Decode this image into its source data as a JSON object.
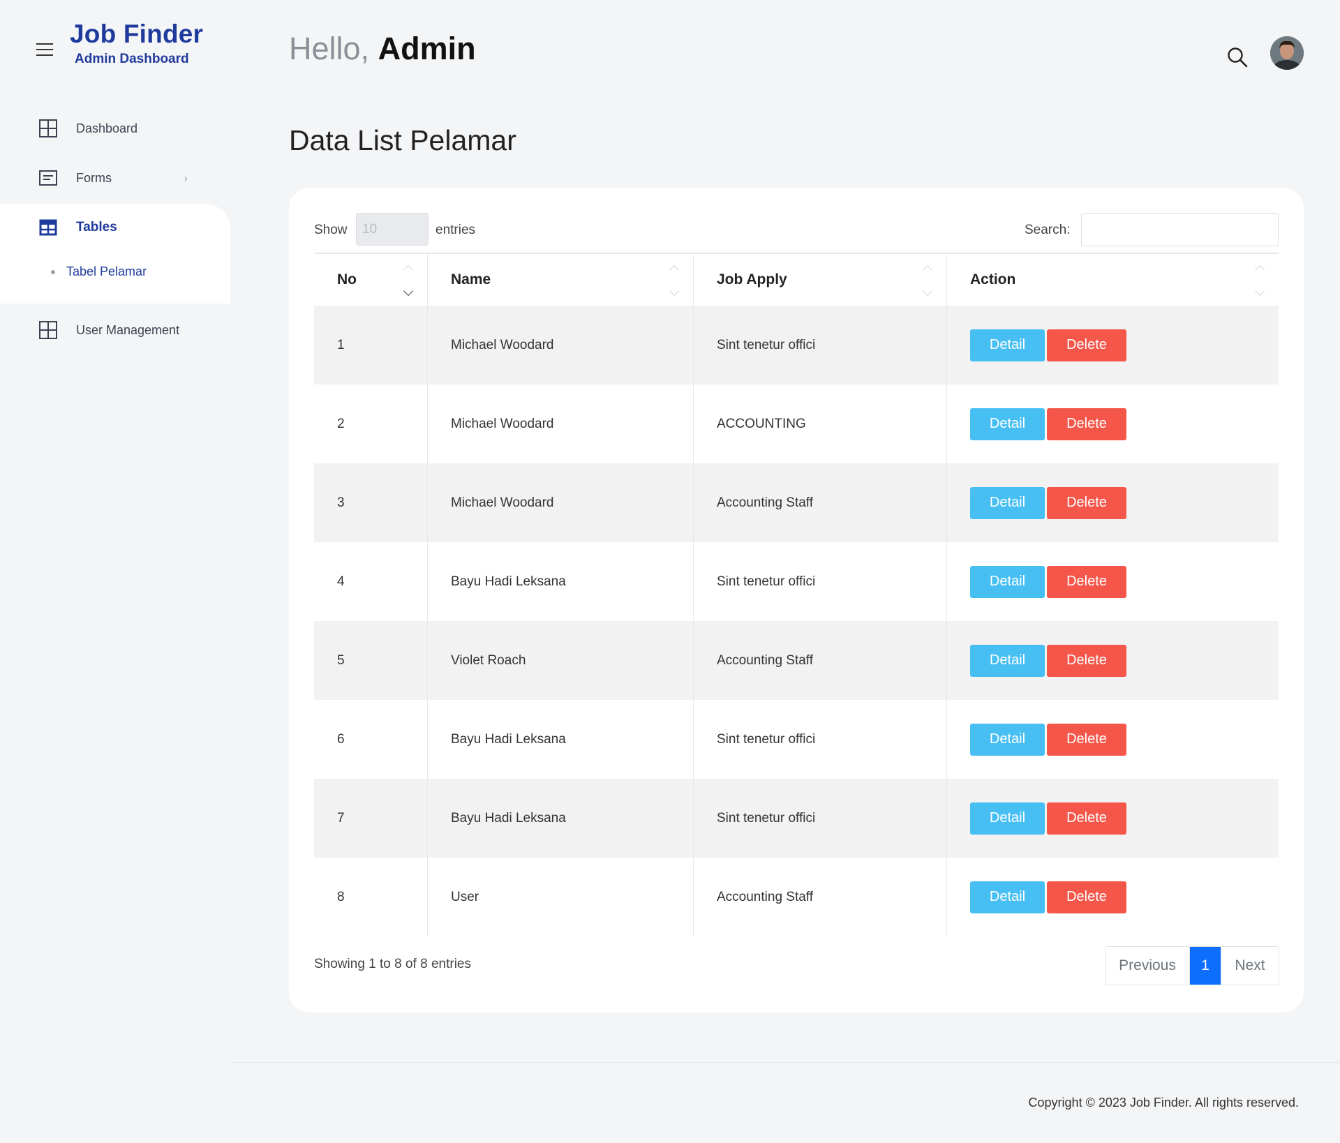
{
  "brand": {
    "title": "Job Finder",
    "subtitle": "Admin Dashboard"
  },
  "sidebar": {
    "items": [
      {
        "label": "Dashboard",
        "icon": "grid-icon"
      },
      {
        "label": "Forms",
        "icon": "form-icon",
        "chevron": "›"
      },
      {
        "label": "Tables",
        "icon": "table-icon",
        "active": true
      },
      {
        "label": "User Management",
        "icon": "grid-icon"
      }
    ],
    "subitems": [
      {
        "label": "Tabel Pelamar"
      }
    ]
  },
  "header": {
    "greeting": "Hello,",
    "user": "Admin"
  },
  "page": {
    "title": "Data List Pelamar"
  },
  "table_controls": {
    "show_label": "Show",
    "entries_value": "10",
    "entries_label": "entries",
    "search_label": "Search:",
    "search_value": ""
  },
  "table": {
    "columns": [
      "No",
      "Name",
      "Job Apply",
      "Action"
    ],
    "rows": [
      {
        "no": "1",
        "name": "Michael Woodard",
        "job": "Sint tenetur offici"
      },
      {
        "no": "2",
        "name": "Michael Woodard",
        "job": "ACCOUNTING"
      },
      {
        "no": "3",
        "name": "Michael Woodard",
        "job": "Accounting Staff"
      },
      {
        "no": "4",
        "name": "Bayu Hadi Leksana",
        "job": "Sint tenetur offici"
      },
      {
        "no": "5",
        "name": "Violet Roach",
        "job": "Accounting Staff"
      },
      {
        "no": "6",
        "name": "Bayu Hadi Leksana",
        "job": "Sint tenetur offici"
      },
      {
        "no": "7",
        "name": "Bayu Hadi Leksana",
        "job": "Sint tenetur offici"
      },
      {
        "no": "8",
        "name": "User",
        "job": "Accounting Staff"
      }
    ],
    "detail_label": "Detail",
    "delete_label": "Delete"
  },
  "pagination": {
    "info": "Showing 1 to 8 of 8 entries",
    "previous": "Previous",
    "current": "1",
    "next": "Next"
  },
  "footer": {
    "copyright": "Copyright © 2023 Job Finder. All rights reserved."
  },
  "colors": {
    "brand": "#1f3a9d",
    "detail_button": "#48bff3",
    "delete_button": "#f5564a",
    "page_active": "#0d6efd"
  }
}
